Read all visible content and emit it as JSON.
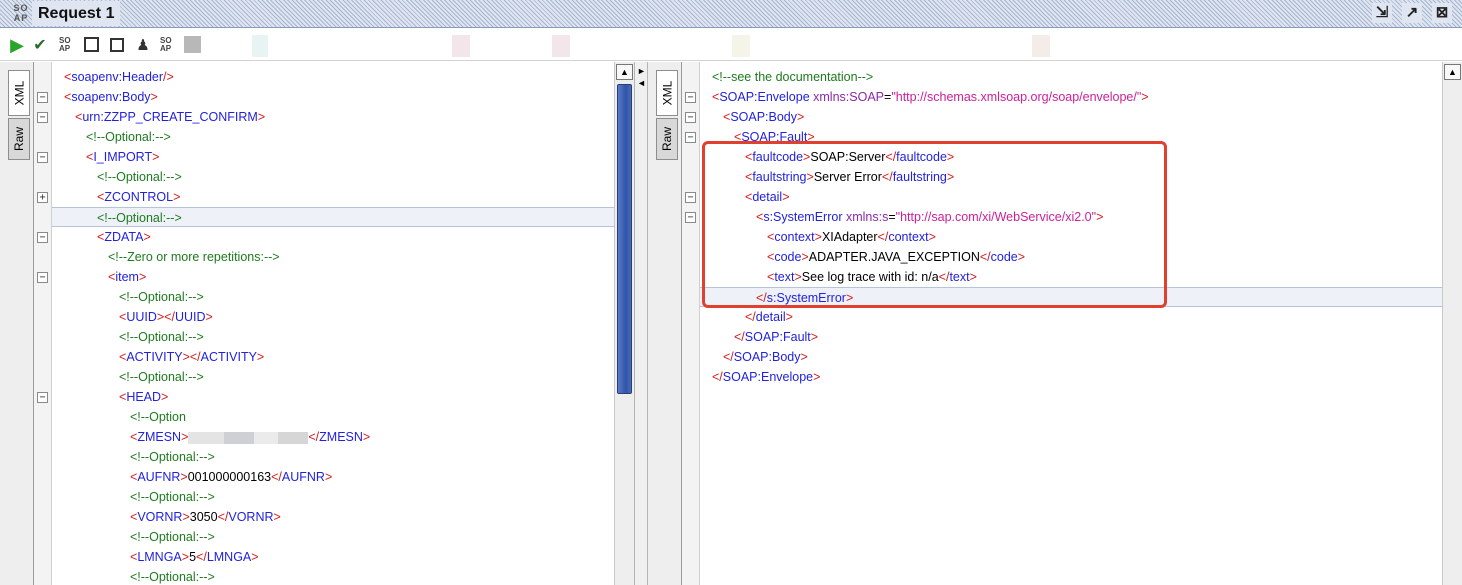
{
  "window": {
    "title": "Request 1",
    "logo_text": "SO AP",
    "buttons": [
      "detach-icon",
      "maximize-icon",
      "close-icon"
    ]
  },
  "toolbar": {
    "icons": [
      "submit-icon",
      "run-step-icon",
      "soap-icon",
      "frame-icon",
      "square-icon",
      "user-icon",
      "soap-icon",
      "block-icon"
    ],
    "play_glyph": "▶",
    "run_glyph": "✔",
    "soap_glyph": "SO AP",
    "person_glyph": "♟"
  },
  "request_pane": {
    "tabs": [
      "XML",
      "Raw"
    ],
    "lines": [
      {
        "indent": 0,
        "tokens": [
          {
            "t": "br",
            "v": "<"
          },
          {
            "t": "el",
            "v": "soapenv:Header"
          },
          {
            "t": "br",
            "v": "/>"
          }
        ]
      },
      {
        "indent": 0,
        "fold": "-",
        "tokens": [
          {
            "t": "br",
            "v": "<"
          },
          {
            "t": "el",
            "v": "soapenv:Body"
          },
          {
            "t": "br",
            "v": ">"
          }
        ]
      },
      {
        "indent": 1,
        "fold": "-",
        "tokens": [
          {
            "t": "br",
            "v": "<"
          },
          {
            "t": "el",
            "v": "urn:ZZPP_CREATE_CONFIRM"
          },
          {
            "t": "br",
            "v": ">"
          }
        ]
      },
      {
        "indent": 2,
        "tokens": [
          {
            "t": "com",
            "v": "<!--Optional:-->"
          }
        ]
      },
      {
        "indent": 2,
        "fold": "-",
        "tokens": [
          {
            "t": "br",
            "v": "<"
          },
          {
            "t": "el",
            "v": "I_IMPORT"
          },
          {
            "t": "br",
            "v": ">"
          }
        ]
      },
      {
        "indent": 3,
        "tokens": [
          {
            "t": "com",
            "v": "<!--Optional:-->"
          }
        ]
      },
      {
        "indent": 3,
        "fold": "+",
        "tokens": [
          {
            "t": "br",
            "v": "<"
          },
          {
            "t": "el",
            "v": "ZCONTROL"
          },
          {
            "t": "br",
            "v": ">"
          }
        ]
      },
      {
        "indent": 3,
        "hl": true,
        "tokens": [
          {
            "t": "com",
            "v": "<!--Optional:-->"
          }
        ]
      },
      {
        "indent": 3,
        "fold": "-",
        "tokens": [
          {
            "t": "br",
            "v": "<"
          },
          {
            "t": "el",
            "v": "ZDATA"
          },
          {
            "t": "br",
            "v": ">"
          }
        ]
      },
      {
        "indent": 4,
        "tokens": [
          {
            "t": "com",
            "v": "<!--Zero or more repetitions:-->"
          }
        ]
      },
      {
        "indent": 4,
        "fold": "-",
        "tokens": [
          {
            "t": "br",
            "v": "<"
          },
          {
            "t": "el",
            "v": "item"
          },
          {
            "t": "br",
            "v": ">"
          }
        ]
      },
      {
        "indent": 5,
        "tokens": [
          {
            "t": "com",
            "v": "<!--Optional:-->"
          }
        ]
      },
      {
        "indent": 5,
        "tokens": [
          {
            "t": "br",
            "v": "<"
          },
          {
            "t": "el",
            "v": "UUID"
          },
          {
            "t": "br",
            "v": "></"
          },
          {
            "t": "el",
            "v": "UUID"
          },
          {
            "t": "br",
            "v": ">"
          }
        ]
      },
      {
        "indent": 5,
        "tokens": [
          {
            "t": "com",
            "v": "<!--Optional:-->"
          }
        ]
      },
      {
        "indent": 5,
        "tokens": [
          {
            "t": "br",
            "v": "<"
          },
          {
            "t": "el",
            "v": "ACTIVITY"
          },
          {
            "t": "br",
            "v": "></"
          },
          {
            "t": "el",
            "v": "ACTIVITY"
          },
          {
            "t": "br",
            "v": ">"
          }
        ]
      },
      {
        "indent": 5,
        "tokens": [
          {
            "t": "com",
            "v": "<!--Optional:-->"
          }
        ]
      },
      {
        "indent": 5,
        "fold": "-",
        "tokens": [
          {
            "t": "br",
            "v": "<"
          },
          {
            "t": "el",
            "v": "HEAD"
          },
          {
            "t": "br",
            "v": ">"
          }
        ]
      },
      {
        "indent": 6,
        "tokens": [
          {
            "t": "com",
            "v": "<!--Option"
          }
        ]
      },
      {
        "indent": 6,
        "tokens": [
          {
            "t": "br",
            "v": "<"
          },
          {
            "t": "el",
            "v": "ZMESN"
          },
          {
            "t": "br",
            "v": ">"
          },
          {
            "t": "mask",
            "v": ""
          },
          {
            "t": "br",
            "v": "</"
          },
          {
            "t": "el",
            "v": "ZMESN"
          },
          {
            "t": "br",
            "v": ">"
          }
        ]
      },
      {
        "indent": 6,
        "tokens": [
          {
            "t": "com",
            "v": "<!--Optional:-->"
          }
        ]
      },
      {
        "indent": 6,
        "tokens": [
          {
            "t": "br",
            "v": "<"
          },
          {
            "t": "el",
            "v": "AUFNR"
          },
          {
            "t": "br",
            "v": ">"
          },
          {
            "t": "txt",
            "v": "001000000163"
          },
          {
            "t": "br",
            "v": "</"
          },
          {
            "t": "el",
            "v": "AUFNR"
          },
          {
            "t": "br",
            "v": ">"
          }
        ]
      },
      {
        "indent": 6,
        "tokens": [
          {
            "t": "com",
            "v": "<!--Optional:-->"
          }
        ]
      },
      {
        "indent": 6,
        "tokens": [
          {
            "t": "br",
            "v": "<"
          },
          {
            "t": "el",
            "v": "VORNR"
          },
          {
            "t": "br",
            "v": ">"
          },
          {
            "t": "txt",
            "v": "3050"
          },
          {
            "t": "br",
            "v": "</"
          },
          {
            "t": "el",
            "v": "VORNR"
          },
          {
            "t": "br",
            "v": ">"
          }
        ]
      },
      {
        "indent": 6,
        "tokens": [
          {
            "t": "com",
            "v": "<!--Optional:-->"
          }
        ]
      },
      {
        "indent": 6,
        "tokens": [
          {
            "t": "br",
            "v": "<"
          },
          {
            "t": "el",
            "v": "LMNGA"
          },
          {
            "t": "br",
            "v": ">"
          },
          {
            "t": "txt",
            "v": "5"
          },
          {
            "t": "br",
            "v": "</"
          },
          {
            "t": "el",
            "v": "LMNGA"
          },
          {
            "t": "br",
            "v": ">"
          }
        ]
      },
      {
        "indent": 6,
        "tokens": [
          {
            "t": "com",
            "v": "<!--Optional:-->"
          }
        ]
      }
    ]
  },
  "response_pane": {
    "tabs": [
      "XML",
      "Raw"
    ],
    "lines": [
      {
        "indent": 0,
        "tokens": [
          {
            "t": "com",
            "v": "<!--see the documentation-->"
          }
        ]
      },
      {
        "indent": 0,
        "fold": "-",
        "tokens": [
          {
            "t": "br",
            "v": "<"
          },
          {
            "t": "el",
            "v": "SOAP:Envelope"
          },
          {
            "t": "txt",
            "v": " "
          },
          {
            "t": "at",
            "v": "xmlns:SOAP"
          },
          {
            "t": "txt",
            "v": "="
          },
          {
            "t": "val",
            "v": "\"http://schemas.xmlsoap.org/soap/envelope/\""
          },
          {
            "t": "br",
            "v": ">"
          }
        ]
      },
      {
        "indent": 1,
        "fold": "-",
        "tokens": [
          {
            "t": "br",
            "v": "<"
          },
          {
            "t": "el",
            "v": "SOAP:Body"
          },
          {
            "t": "br",
            "v": ">"
          }
        ]
      },
      {
        "indent": 2,
        "fold": "-",
        "tokens": [
          {
            "t": "br",
            "v": "<"
          },
          {
            "t": "el",
            "v": "SOAP:Fault"
          },
          {
            "t": "br",
            "v": ">"
          }
        ]
      },
      {
        "indent": 3,
        "tokens": [
          {
            "t": "br",
            "v": "<"
          },
          {
            "t": "el",
            "v": "faultcode"
          },
          {
            "t": "br",
            "v": ">"
          },
          {
            "t": "txt",
            "v": "SOAP:Server"
          },
          {
            "t": "br",
            "v": "</"
          },
          {
            "t": "el",
            "v": "faultcode"
          },
          {
            "t": "br",
            "v": ">"
          }
        ]
      },
      {
        "indent": 3,
        "tokens": [
          {
            "t": "br",
            "v": "<"
          },
          {
            "t": "el",
            "v": "faultstring"
          },
          {
            "t": "br",
            "v": ">"
          },
          {
            "t": "txt",
            "v": "Server Error"
          },
          {
            "t": "br",
            "v": "</"
          },
          {
            "t": "el",
            "v": "faultstring"
          },
          {
            "t": "br",
            "v": ">"
          }
        ]
      },
      {
        "indent": 3,
        "fold": "-",
        "tokens": [
          {
            "t": "br",
            "v": "<"
          },
          {
            "t": "el",
            "v": "detail"
          },
          {
            "t": "br",
            "v": ">"
          }
        ]
      },
      {
        "indent": 4,
        "fold": "-",
        "tokens": [
          {
            "t": "br",
            "v": "<"
          },
          {
            "t": "el",
            "v": "s:SystemError"
          },
          {
            "t": "txt",
            "v": " "
          },
          {
            "t": "at",
            "v": "xmlns:s"
          },
          {
            "t": "txt",
            "v": "="
          },
          {
            "t": "val",
            "v": "\"http://sap.com/xi/WebService/xi2.0\""
          },
          {
            "t": "br",
            "v": ">"
          }
        ]
      },
      {
        "indent": 5,
        "tokens": [
          {
            "t": "br",
            "v": "<"
          },
          {
            "t": "el",
            "v": "context"
          },
          {
            "t": "br",
            "v": ">"
          },
          {
            "t": "txt",
            "v": "XIAdapter"
          },
          {
            "t": "br",
            "v": "</"
          },
          {
            "t": "el",
            "v": "context"
          },
          {
            "t": "br",
            "v": ">"
          }
        ]
      },
      {
        "indent": 5,
        "tokens": [
          {
            "t": "br",
            "v": "<"
          },
          {
            "t": "el",
            "v": "code"
          },
          {
            "t": "br",
            "v": ">"
          },
          {
            "t": "txt",
            "v": "ADAPTER.JAVA_EXCEPTION"
          },
          {
            "t": "br",
            "v": "</"
          },
          {
            "t": "el",
            "v": "code"
          },
          {
            "t": "br",
            "v": ">"
          }
        ]
      },
      {
        "indent": 5,
        "tokens": [
          {
            "t": "br",
            "v": "<"
          },
          {
            "t": "el",
            "v": "text"
          },
          {
            "t": "br",
            "v": ">"
          },
          {
            "t": "txt",
            "v": "See log trace with id: n/a"
          },
          {
            "t": "br",
            "v": "</"
          },
          {
            "t": "el",
            "v": "text"
          },
          {
            "t": "br",
            "v": ">"
          }
        ]
      },
      {
        "indent": 4,
        "hl": true,
        "tokens": [
          {
            "t": "br",
            "v": "</"
          },
          {
            "t": "el",
            "v": "s:SystemError"
          },
          {
            "t": "br",
            "v": ">"
          }
        ]
      },
      {
        "indent": 3,
        "tokens": [
          {
            "t": "br",
            "v": "</"
          },
          {
            "t": "el",
            "v": "detail"
          },
          {
            "t": "br",
            "v": ">"
          }
        ]
      },
      {
        "indent": 2,
        "tokens": [
          {
            "t": "br",
            "v": "</"
          },
          {
            "t": "el",
            "v": "SOAP:Fault"
          },
          {
            "t": "br",
            "v": ">"
          }
        ]
      },
      {
        "indent": 1,
        "tokens": [
          {
            "t": "br",
            "v": "</"
          },
          {
            "t": "el",
            "v": "SOAP:Body"
          },
          {
            "t": "br",
            "v": ">"
          }
        ]
      },
      {
        "indent": 0,
        "tokens": [
          {
            "t": "br",
            "v": "</"
          },
          {
            "t": "el",
            "v": "SOAP:Envelope"
          },
          {
            "t": "br",
            "v": ">"
          }
        ]
      }
    ]
  },
  "colors": {
    "bracket": "#d21c1c",
    "element": "#2222dd",
    "attribute": "#8a28a8",
    "value": "#cc1f9a",
    "comment": "#1e7a1e",
    "highlight_box": "#e2402e"
  }
}
